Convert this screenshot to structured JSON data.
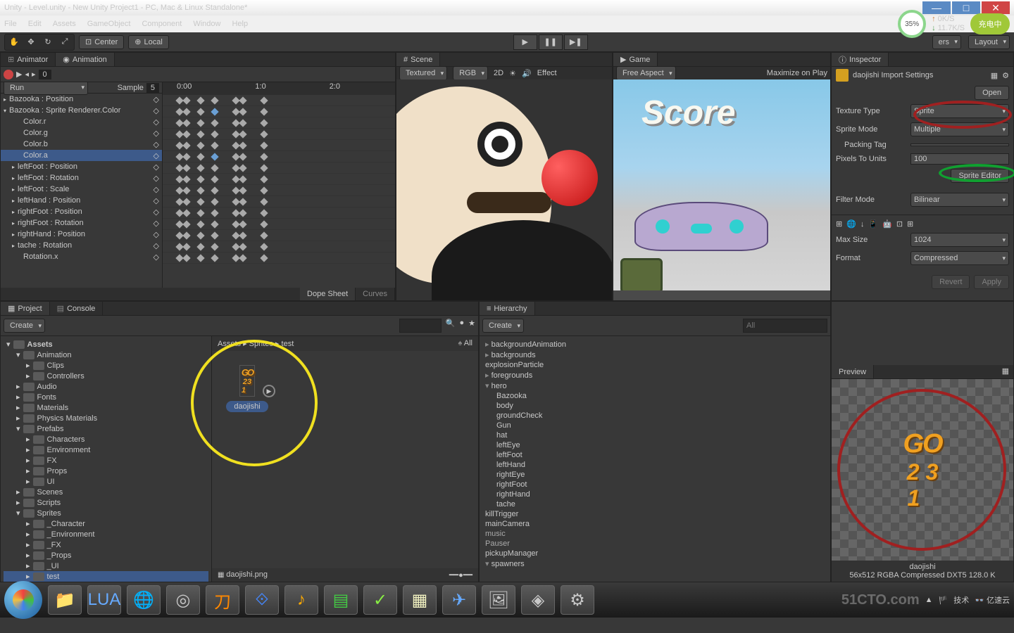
{
  "title": "Unity - Level.unity - New Unity Project1 - PC, Mac & Linux Standalone*",
  "menu": [
    "File",
    "Edit",
    "Assets",
    "GameObject",
    "Component",
    "Window",
    "Help"
  ],
  "status": {
    "pct": "35%",
    "up": "0K/S",
    "down": "11.7K/S",
    "bat": "充电中"
  },
  "toolbar": {
    "center": "Center",
    "local": "Local",
    "layers": "ers",
    "layout": "Layout"
  },
  "anim": {
    "tab1": "Animator",
    "tab2": "Animation",
    "run": "Run",
    "sample": "Sample",
    "sample_val": "5",
    "frame": "0",
    "times": [
      "0:00",
      "1:0",
      "2:0"
    ],
    "props": [
      {
        "t": "▸",
        "l": "Bazooka : Position",
        "i": 0
      },
      {
        "t": "▾",
        "l": "Bazooka : Sprite Renderer.Color",
        "i": 0
      },
      {
        "t": "",
        "l": "Color.r",
        "i": 2
      },
      {
        "t": "",
        "l": "Color.g",
        "i": 2
      },
      {
        "t": "",
        "l": "Color.b",
        "i": 2
      },
      {
        "t": "",
        "l": "Color.a",
        "i": 2,
        "sel": true
      },
      {
        "t": "▸",
        "l": "leftFoot : Position",
        "i": 1
      },
      {
        "t": "▸",
        "l": "leftFoot : Rotation",
        "i": 1
      },
      {
        "t": "▸",
        "l": "leftFoot : Scale",
        "i": 1
      },
      {
        "t": "▸",
        "l": "leftHand : Position",
        "i": 1
      },
      {
        "t": "▸",
        "l": "rightFoot : Position",
        "i": 1
      },
      {
        "t": "▸",
        "l": "rightFoot : Rotation",
        "i": 1
      },
      {
        "t": "▸",
        "l": "rightHand : Position",
        "i": 1
      },
      {
        "t": "▸",
        "l": "tache : Rotation",
        "i": 1
      },
      {
        "t": "",
        "l": "Rotation.x",
        "i": 2
      }
    ],
    "dope": "Dope Sheet",
    "curves": "Curves"
  },
  "scene": {
    "tab": "Scene",
    "textured": "Textured",
    "rgb": "RGB",
    "2d": "2D",
    "eff": "Effect"
  },
  "game": {
    "tab": "Game",
    "aspect": "Free Aspect",
    "max": "Maximize on Play",
    "score": "Score"
  },
  "inspector": {
    "tab": "Inspector",
    "asset": "daojishi Import Settings",
    "open": "Open",
    "texType": "Texture Type",
    "texTypeV": "Sprite",
    "spriteMode": "Sprite Mode",
    "spriteModeV": "Multiple",
    "packing": "Packing Tag",
    "ppu": "Pixels To Units",
    "ppuV": "100",
    "spriteEditor": "Sprite Editor",
    "filter": "Filter Mode",
    "filterV": "Bilinear",
    "maxSize": "Max Size",
    "maxSizeV": "1024",
    "format": "Format",
    "formatV": "Compressed",
    "revert": "Revert",
    "apply": "Apply"
  },
  "project": {
    "tab1": "Project",
    "tab2": "Console",
    "create": "Create",
    "root": "Assets",
    "tree": [
      {
        "l": "Animation",
        "i": 1,
        "exp": true
      },
      {
        "l": "Clips",
        "i": 2
      },
      {
        "l": "Controllers",
        "i": 2
      },
      {
        "l": "Audio",
        "i": 1
      },
      {
        "l": "Fonts",
        "i": 1
      },
      {
        "l": "Materials",
        "i": 1
      },
      {
        "l": "Physics Materials",
        "i": 1
      },
      {
        "l": "Prefabs",
        "i": 1,
        "exp": true
      },
      {
        "l": "Characters",
        "i": 2
      },
      {
        "l": "Environment",
        "i": 2
      },
      {
        "l": "FX",
        "i": 2
      },
      {
        "l": "Props",
        "i": 2
      },
      {
        "l": "UI",
        "i": 2
      },
      {
        "l": "Scenes",
        "i": 1
      },
      {
        "l": "Scripts",
        "i": 1
      },
      {
        "l": "Sprites",
        "i": 1,
        "exp": true
      },
      {
        "l": "_Character",
        "i": 2
      },
      {
        "l": "_Environment",
        "i": 2
      },
      {
        "l": "_FX",
        "i": 2
      },
      {
        "l": "_Props",
        "i": 2
      },
      {
        "l": "_UI",
        "i": 2
      },
      {
        "l": "test",
        "i": 2,
        "sel": true
      }
    ],
    "breadcrumb": "Assets ▸ Sprites ▸ test",
    "asset": "daojishi",
    "all": "All",
    "file": "daojishi.png"
  },
  "hierarchy": {
    "tab": "Hierarchy",
    "create": "Create",
    "all": "All",
    "items": [
      {
        "l": "backgroundAnimation",
        "t": "exp"
      },
      {
        "l": "backgrounds",
        "t": "exp"
      },
      {
        "l": "explosionParticle",
        "t": ""
      },
      {
        "l": "foregrounds",
        "t": "exp"
      },
      {
        "l": "hero",
        "t": "down"
      },
      {
        "l": "Bazooka",
        "t": "",
        "i": 1
      },
      {
        "l": "body",
        "t": "",
        "i": 1
      },
      {
        "l": "groundCheck",
        "t": "",
        "i": 1
      },
      {
        "l": "Gun",
        "t": "",
        "i": 1
      },
      {
        "l": "hat",
        "t": "",
        "i": 1
      },
      {
        "l": "leftEye",
        "t": "",
        "i": 1
      },
      {
        "l": "leftFoot",
        "t": "",
        "i": 1
      },
      {
        "l": "leftHand",
        "t": "",
        "i": 1
      },
      {
        "l": "rightEye",
        "t": "",
        "i": 1
      },
      {
        "l": "rightFoot",
        "t": "",
        "i": 1
      },
      {
        "l": "rightHand",
        "t": "",
        "i": 1
      },
      {
        "l": "tache",
        "t": "",
        "i": 1
      },
      {
        "l": "killTrigger",
        "t": ""
      },
      {
        "l": "mainCamera",
        "t": ""
      },
      {
        "l": "music",
        "t": "",
        "gray": true
      },
      {
        "l": "Pauser",
        "t": "",
        "gray": true
      },
      {
        "l": "pickupManager",
        "t": ""
      },
      {
        "l": "spawners",
        "t": "down"
      }
    ]
  },
  "preview": {
    "tab": "Preview",
    "name": "daojishi",
    "info": "56x512  RGBA Compressed DXT5    128.0 K"
  },
  "wm1": "51CTO.com",
  "wm2": "亿速云"
}
